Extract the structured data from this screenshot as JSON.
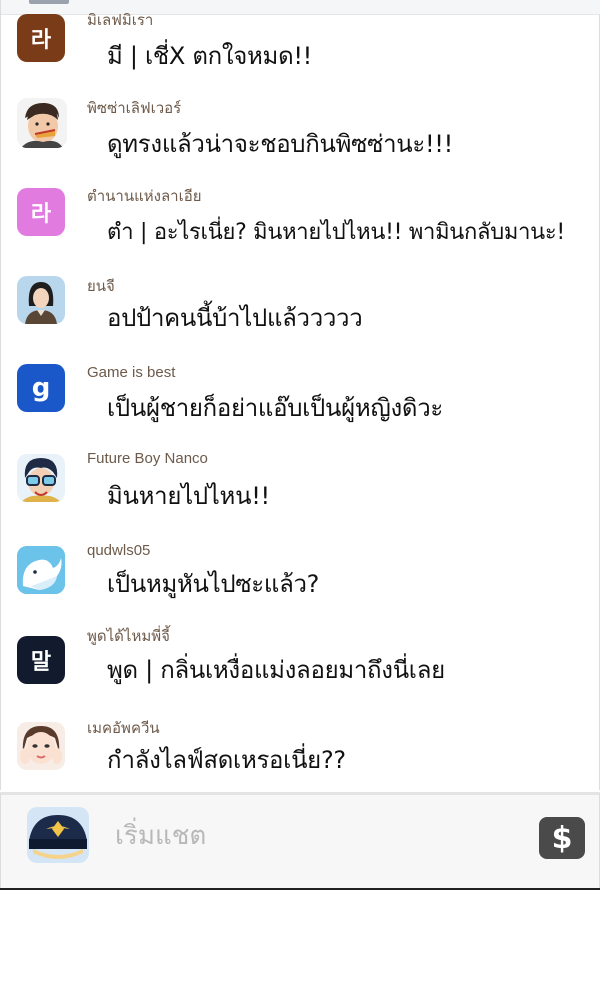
{
  "messages": [
    {
      "username": "มิเลฟมิเรา",
      "text": "มี | เชี่X ตกใจหมด!!",
      "avatar_glyph": "라",
      "avatar_color": "#7a3b18",
      "avatar_kind": "letter"
    },
    {
      "username": "พิซซ่าเลิฟเวอร์",
      "text": "ดูทรงแล้วน่าจะชอบกินพิซซ่านะ!!!",
      "avatar_kind": "man-eating"
    },
    {
      "username": "ตำนานแห่งลาเอีย",
      "text": "ตำ | อะไรเนี่ย? มินหายไปไหน!! พามินกลับมานะ!",
      "avatar_glyph": "라",
      "avatar_color": "#e27be0",
      "avatar_kind": "letter"
    },
    {
      "username": "ยนจี",
      "text": "อปป้าคนนี้บ้าไปแล้ววววว",
      "avatar_kind": "woman-portrait"
    },
    {
      "username": "Game is best",
      "text": "เป็นผู้ชายก็อย่าแอ๊บเป็นผู้หญิงดิวะ",
      "avatar_glyph": "g",
      "avatar_color": "#1a57c9",
      "avatar_kind": "letter"
    },
    {
      "username": "Future Boy Nanco",
      "text": "มินหายไปไหน!!",
      "avatar_kind": "boy-goggles"
    },
    {
      "username": "qudwls05",
      "text": "เป็นหมูหันไปซะแล้ว?",
      "avatar_kind": "whale"
    },
    {
      "username": "พูดได้ไหมพี่จี้",
      "text": "พูด | กลิ่นเหงื่อแม่งลอยมาถึงนี่เลย",
      "avatar_glyph": "말",
      "avatar_color": "#121a2e",
      "avatar_kind": "letter"
    },
    {
      "username": "เมคอัพควีน",
      "text": "กำลังไลฟ์สดเหรอเนี่ย??",
      "avatar_kind": "woman-face"
    }
  ],
  "composer": {
    "placeholder": "เริ่มแชต",
    "avatar_kind": "police-cap",
    "dollar_icon": "$"
  },
  "colors": {
    "username": "#6d5a4a",
    "message_text": "#111111",
    "composer_bg": "#f7f7f7",
    "dollar_button": "#4a4a4a"
  }
}
